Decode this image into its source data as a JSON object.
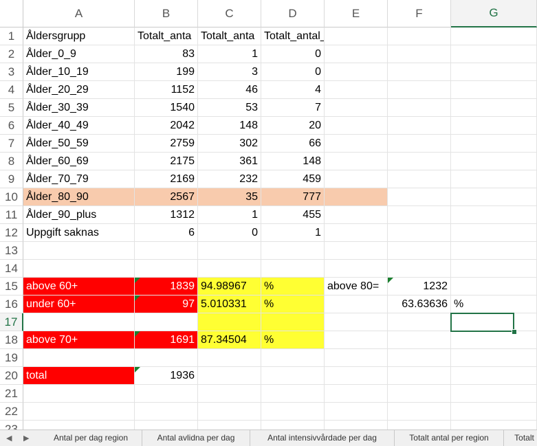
{
  "columns": [
    "A",
    "B",
    "C",
    "D",
    "E",
    "F",
    "G"
  ],
  "selected_column": "G",
  "selected_row": "17",
  "rows": [
    {
      "n": "1",
      "A": "Åldersgrupp",
      "B": "Totalt_anta",
      "C": "Totalt_anta",
      "D": "Totalt_antal_avlidna",
      "E": "",
      "F": "",
      "G": ""
    },
    {
      "n": "2",
      "A": "Ålder_0_9",
      "B": "83",
      "C": "1",
      "D": "0",
      "E": "",
      "F": "",
      "G": ""
    },
    {
      "n": "3",
      "A": "Ålder_10_19",
      "B": "199",
      "C": "3",
      "D": "0",
      "E": "",
      "F": "",
      "G": ""
    },
    {
      "n": "4",
      "A": "Ålder_20_29",
      "B": "1152",
      "C": "46",
      "D": "4",
      "E": "",
      "F": "",
      "G": ""
    },
    {
      "n": "5",
      "A": "Ålder_30_39",
      "B": "1540",
      "C": "53",
      "D": "7",
      "E": "",
      "F": "",
      "G": ""
    },
    {
      "n": "6",
      "A": "Ålder_40_49",
      "B": "2042",
      "C": "148",
      "D": "20",
      "E": "",
      "F": "",
      "G": ""
    },
    {
      "n": "7",
      "A": "Ålder_50_59",
      "B": "2759",
      "C": "302",
      "D": "66",
      "E": "",
      "F": "",
      "G": ""
    },
    {
      "n": "8",
      "A": "Ålder_60_69",
      "B": "2175",
      "C": "361",
      "D": "148",
      "E": "",
      "F": "",
      "G": ""
    },
    {
      "n": "9",
      "A": "Ålder_70_79",
      "B": "2169",
      "C": "232",
      "D": "459",
      "E": "",
      "F": "",
      "G": ""
    },
    {
      "n": "10",
      "A": "Ålder_80_90",
      "B": "2567",
      "C": "35",
      "D": "777",
      "E": "",
      "F": "",
      "G": ""
    },
    {
      "n": "11",
      "A": "Ålder_90_plus",
      "B": "1312",
      "C": "1",
      "D": "455",
      "E": "",
      "F": "",
      "G": ""
    },
    {
      "n": "12",
      "A": "Uppgift saknas",
      "B": "6",
      "C": "0",
      "D": "1",
      "E": "",
      "F": "",
      "G": ""
    },
    {
      "n": "13",
      "A": "",
      "B": "",
      "C": "",
      "D": "",
      "E": "",
      "F": "",
      "G": ""
    },
    {
      "n": "14",
      "A": "",
      "B": "",
      "C": "",
      "D": "",
      "E": "",
      "F": "",
      "G": ""
    },
    {
      "n": "15",
      "A": "above 60+",
      "B": "1839",
      "C": "94.98967",
      "D": "%",
      "E": "above 80=",
      "F": "1232",
      "G": ""
    },
    {
      "n": "16",
      "A": "under 60+",
      "B": "97",
      "C": "5.010331",
      "D": "%",
      "E": "",
      "F": "63.63636",
      "G": "%"
    },
    {
      "n": "17",
      "A": "",
      "B": "",
      "C": "",
      "D": "",
      "E": "",
      "F": "",
      "G": ""
    },
    {
      "n": "18",
      "A": "above 70+",
      "B": "1691",
      "C": "87.34504",
      "D": "%",
      "E": "",
      "F": "",
      "G": ""
    },
    {
      "n": "19",
      "A": "",
      "B": "",
      "C": "",
      "D": "",
      "E": "",
      "F": "",
      "G": ""
    },
    {
      "n": "20",
      "A": "total",
      "B": "1936",
      "C": "",
      "D": "",
      "E": "",
      "F": "",
      "G": ""
    },
    {
      "n": "21",
      "A": "",
      "B": "",
      "C": "",
      "D": "",
      "E": "",
      "F": "",
      "G": ""
    },
    {
      "n": "22",
      "A": "",
      "B": "",
      "C": "",
      "D": "",
      "E": "",
      "F": "",
      "G": ""
    },
    {
      "n": "23",
      "A": "",
      "B": "",
      "C": "",
      "D": "",
      "E": "",
      "F": "",
      "G": ""
    }
  ],
  "sheet_tabs": [
    "Antal per dag region",
    "Antal avlidna per dag",
    "Antal intensivvårdade per dag",
    "Totalt antal per region",
    "Totalt"
  ],
  "nav_icons": [
    "triangle-left-icon",
    "triangle-right-icon"
  ],
  "colors": {
    "red": "#ff0000",
    "yellow": "#ffff33",
    "peach": "#f8cbad",
    "accent": "#217346"
  }
}
